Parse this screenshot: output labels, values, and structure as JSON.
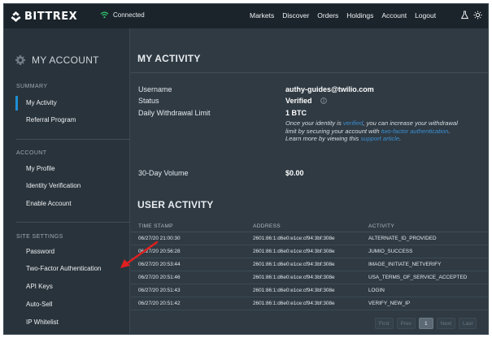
{
  "header": {
    "brand": "BITTREX",
    "connection_status": "Connected",
    "nav": [
      "Markets",
      "Discover",
      "Orders",
      "Holdings",
      "Account",
      "Logout"
    ],
    "icons": [
      "flask-icon",
      "sun-icon"
    ]
  },
  "sidebar": {
    "title": "MY ACCOUNT",
    "sections": [
      {
        "label": "SUMMARY",
        "items": [
          "My Activity",
          "Referral Program"
        ]
      },
      {
        "label": "ACCOUNT",
        "items": [
          "My Profile",
          "Identity Verification",
          "Enable Account"
        ]
      },
      {
        "label": "SITE SETTINGS",
        "items": [
          "Password",
          "Two-Factor Authentication",
          "API Keys",
          "Auto-Sell",
          "IP Whitelist"
        ]
      }
    ],
    "active_item": "My Activity"
  },
  "my_activity": {
    "title": "MY ACTIVITY",
    "username_label": "Username",
    "username_value": "authy-guides@twilio.com",
    "status_label": "Status",
    "status_value": "Verified",
    "limit_label": "Daily Withdrawal Limit",
    "limit_value": "1 BTC",
    "note_1": "Once your identity is ",
    "note_link_1": "verified",
    "note_2": ", you can increase your withdrawal limit by securing your account with ",
    "note_link_2": "two-factor authentication",
    "note_3": ". Learn more by viewing this ",
    "note_link_3": "support article",
    "note_4": ".",
    "volume_label": "30-Day Volume",
    "volume_value": "$0.00"
  },
  "user_activity": {
    "title": "USER ACTIVITY",
    "columns": [
      "TIME STAMP",
      "ADDRESS",
      "ACTIVITY"
    ],
    "rows": [
      [
        "06/27/20 21:00:30",
        "2601:86:1:d6e0:e1ce:cf94:3bf:308e",
        "ALTERNATE_ID_PROVIDED"
      ],
      [
        "06/27/20 20:56:28",
        "2601:86:1:d6e0:e1ce:cf94:3bf:308e",
        "JUMIO_SUCCESS"
      ],
      [
        "06/27/20 20:53:44",
        "2601:86:1:d6e0:e1ce:cf94:3bf:308e",
        "IMAGE_INITIATE_NETVERIFY"
      ],
      [
        "06/27/20 20:51:46",
        "2601:86:1:d6e0:e1ce:cf94:3bf:308e",
        "USA_TERMS_OF_SERVICE_ACCEPTED"
      ],
      [
        "06/27/20 20:51:43",
        "2601:86:1:d6e0:e1ce:cf94:3bf:308e",
        "LOGIN"
      ],
      [
        "06/27/20 20:51:42",
        "2601:86:1:d6e0:e1ce:cf94:3bf:308e",
        "VERIFY_NEW_IP"
      ]
    ],
    "pagination": {
      "first": "First",
      "prev": "Prev",
      "current": "1",
      "next": "Next",
      "last": "Last"
    }
  },
  "colors": {
    "topbar": "#1b242b",
    "background": "#2f3a43",
    "sidebar": "#29333b",
    "accent": "#1e8fd5",
    "link": "#3d8fd1",
    "connected": "#2ecc71",
    "annotation_arrow": "#e02020"
  }
}
